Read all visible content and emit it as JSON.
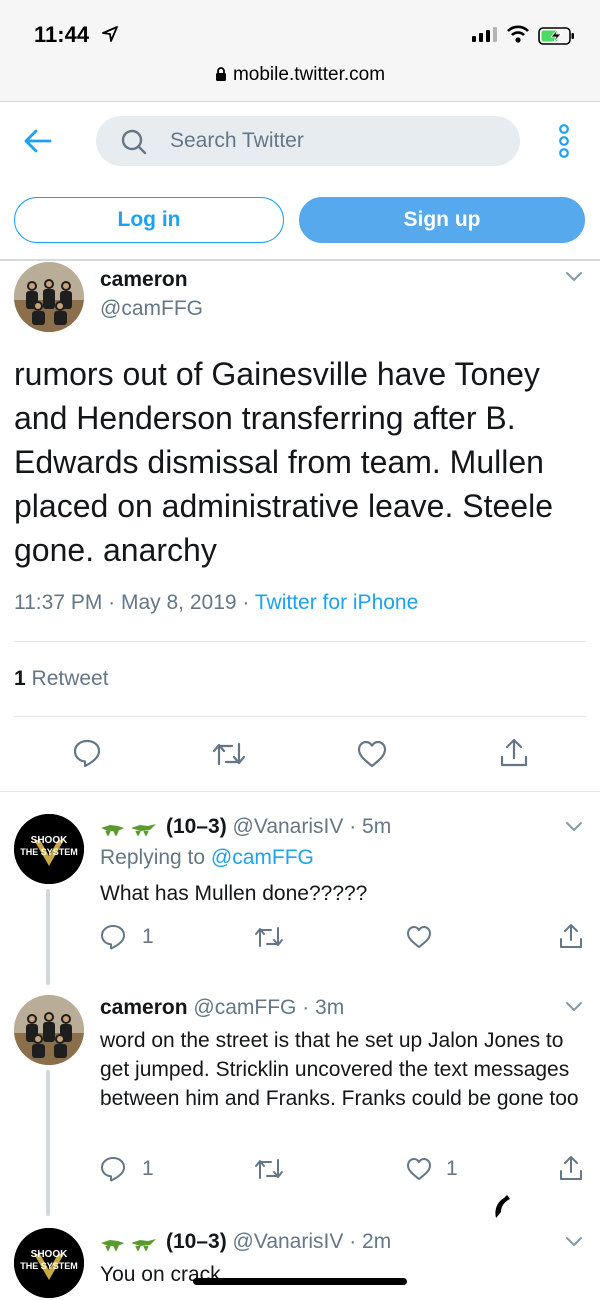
{
  "status": {
    "time": "11:44"
  },
  "browser": {
    "url": "mobile.twitter.com"
  },
  "header": {
    "search_placeholder": "Search Twitter",
    "login_label": "Log in",
    "signup_label": "Sign up"
  },
  "tweet": {
    "name": "cameron",
    "handle": "@camFFG",
    "text": "rumors out of Gainesville have Toney and Henderson transferring after B. Edwards dismissal from team. Mullen placed on administrative leave. Steele gone. anarchy",
    "time": "11:37 PM",
    "date": "May 8, 2019",
    "source": "Twitter for iPhone",
    "retweet_count": "1",
    "retweet_label": "Retweet"
  },
  "replies": [
    {
      "name": "(10–3)",
      "handle": "@VanarisIV",
      "age": "5m",
      "replying_label": "Replying to",
      "replying_to": "@camFFG",
      "text": "What has Mullen done?????",
      "reply_count": "1",
      "like_count": "",
      "avatar_text_1": "SHOOK",
      "avatar_text_2": "THE SYSTEM"
    },
    {
      "name": "cameron",
      "handle": "@camFFG",
      "age": "3m",
      "text": "word on the street is that he set up Jalon Jones to get jumped. Stricklin uncovered the text messages between him and Franks. Franks could be gone too",
      "reply_count": "1",
      "like_count": "1"
    },
    {
      "name": "(10–3)",
      "handle": "@VanarisIV",
      "age": "2m",
      "text": "You on crack",
      "avatar_text_1": "SHOOK",
      "avatar_text_2": "THE SYSTEM"
    }
  ],
  "colors": {
    "accent": "#1da1f2",
    "muted": "#657786",
    "divider": "#e1e8ed"
  }
}
